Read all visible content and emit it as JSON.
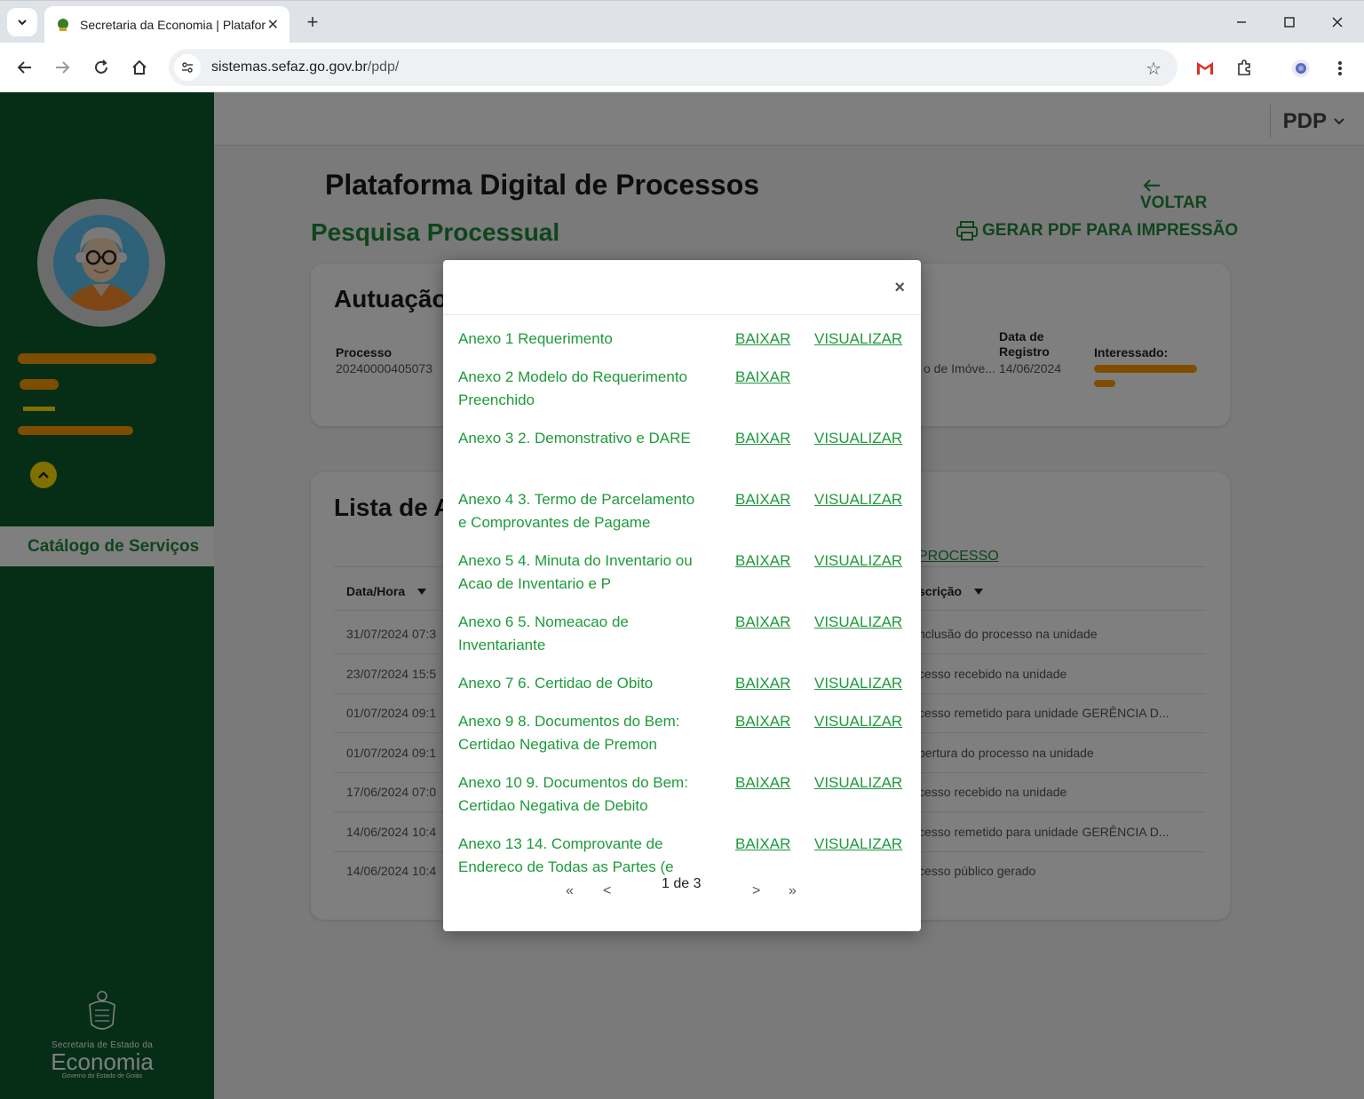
{
  "browser": {
    "tab_title": "Secretaria da Economia | Plataforma",
    "url_host": "sistemas.sefaz.go.gov.br",
    "url_path": "/pdp/"
  },
  "icons": {
    "tab_dropdown": "chevron-down-icon",
    "close": "close-icon",
    "new_tab": "plus-icon",
    "minimize": "minimize-icon",
    "maximize": "maximize-icon",
    "back": "arrow-left-icon",
    "forward": "arrow-right-icon",
    "reload": "reload-icon",
    "home": "home-icon",
    "site_info": "tune-icon",
    "bookmark": "star-icon",
    "gmail": "gmail-icon",
    "extensions": "puzzle-icon",
    "profile": "profile-icon",
    "menu": "kebab-menu-icon",
    "collapse": "chevron-up-icon",
    "printer": "printer-icon"
  },
  "colors": {
    "sidebar_green": "#0d5c2f",
    "accent_green": "#1e8a3a",
    "link_green": "#1e9a3a",
    "highlight_yellow": "#ffe000",
    "redaction_orange": "#ff9a00"
  },
  "sidebar": {
    "catalog_label": "Catálogo de Serviços",
    "logo_line1": "Secretaria de Estado da",
    "logo_line2": "Economia",
    "logo_line3": "Governo do Estado de Goiás"
  },
  "header": {
    "menu_label": "PDP"
  },
  "main": {
    "title": "Plataforma Digital de Processos",
    "subtitle": "Pesquisa Processual",
    "back_label": "VOLTAR",
    "print_label": "GERAR PDF PARA IMPRESSÃO"
  },
  "autuacao": {
    "title": "Autuação",
    "processo_label": "Processo",
    "processo_value": "20240000405073",
    "assunto_value": "o de Imóve...",
    "data_label_1": "Data de",
    "data_label_2": "Registro",
    "data_value": "14/06/2024",
    "interessado_label": "Interessado:"
  },
  "lista": {
    "title": "Lista de A",
    "processo_link": "PROCESSO",
    "col_datahora": "Data/Hora",
    "col_descricao": "scrição",
    "rows": [
      {
        "date": "31/07/2024 07:3",
        "desc": "nclusão do processo na unidade"
      },
      {
        "date": "23/07/2024 15:5",
        "desc": "cesso recebido na unidade"
      },
      {
        "date": "01/07/2024 09:1",
        "desc": "cesso remetido para unidade GERÊNCIA D..."
      },
      {
        "date": "01/07/2024 09:1",
        "desc": "bertura do processo na unidade"
      },
      {
        "date": "17/06/2024 07:0",
        "desc": "cesso recebido na unidade"
      },
      {
        "date": "14/06/2024 10:4",
        "desc": "cesso remetido para unidade GERÊNCIA D..."
      },
      {
        "date": "14/06/2024 10:4",
        "desc": "cesso público gerado"
      }
    ]
  },
  "modal": {
    "close_label": "×",
    "baixar_label": "BAIXAR",
    "visualizar_label": "VISUALIZAR",
    "annexes": [
      {
        "name": "Anexo 1 Requerimento",
        "visualizar": true
      },
      {
        "name": "Anexo 2 Modelo do Requerimento Preenchido",
        "visualizar": false
      },
      {
        "name": "Anexo 3 2. Demonstrativo e DARE",
        "visualizar": true
      },
      {
        "name": "Anexo 4 3. Termo de Parcelamento e Comprovantes de Pagame",
        "visualizar": true
      },
      {
        "name": "Anexo 5 4. Minuta do Inventario ou Acao de Inventario e P",
        "visualizar": true
      },
      {
        "name": "Anexo 6 5. Nomeacao de Inventariante",
        "visualizar": true
      },
      {
        "name": "Anexo 7 6. Certidao de Obito",
        "visualizar": true
      },
      {
        "name": "Anexo 9 8. Documentos do Bem: Certidao Negativa de Premon",
        "visualizar": true
      },
      {
        "name": "Anexo 10 9. Documentos do Bem: Certidao Negativa de Debito",
        "visualizar": true
      },
      {
        "name": "Anexo 13 14. Comprovante de Endereco de Todas as Partes (e",
        "visualizar": true
      }
    ],
    "pagination": {
      "first": "«",
      "prev": "<",
      "label": "1 de 3",
      "next": ">",
      "last": "»"
    }
  }
}
